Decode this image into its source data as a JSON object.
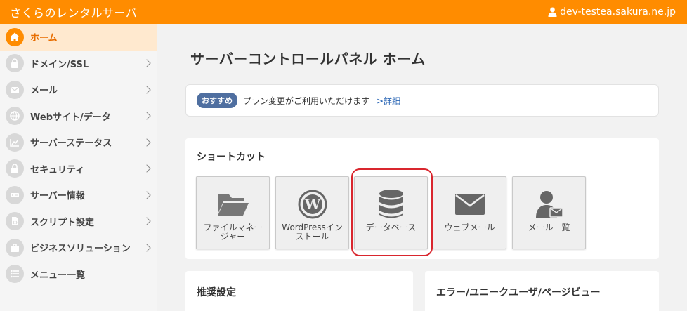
{
  "header": {
    "brand": "さくらのレンタルサーバ",
    "username": "dev-testea.sakura.ne.jp"
  },
  "sidebar": {
    "items": [
      {
        "label": "ホーム",
        "icon": "home-icon",
        "active": true
      },
      {
        "label": "ドメイン/SSL",
        "icon": "lock-icon"
      },
      {
        "label": "メール",
        "icon": "mail-icon"
      },
      {
        "label": "Webサイト/データ",
        "icon": "globe-icon"
      },
      {
        "label": "サーバーステータス",
        "icon": "chart-icon"
      },
      {
        "label": "セキュリティ",
        "icon": "lock-icon"
      },
      {
        "label": "サーバー情報",
        "icon": "server-icon"
      },
      {
        "label": "スクリプト設定",
        "icon": "script-icon"
      },
      {
        "label": "ビジネスソリューション",
        "icon": "briefcase-icon"
      },
      {
        "label": "メニュー一覧",
        "icon": "list-icon"
      }
    ]
  },
  "main": {
    "title": "サーバーコントロールパネル ホーム",
    "notice": {
      "badge": "おすすめ",
      "text": "プラン変更がご利用いただけます",
      "link": ">詳細"
    },
    "shortcuts": {
      "title": "ショートカット",
      "items": [
        {
          "label": "ファイルマネージャー",
          "icon": "folder-icon"
        },
        {
          "label": "WordPressインストール",
          "icon": "wordpress-icon"
        },
        {
          "label": "データベース",
          "icon": "database-icon",
          "highlighted": true
        },
        {
          "label": "ウェブメール",
          "icon": "envelope-icon"
        },
        {
          "label": "メール一覧",
          "icon": "mail-user-icon"
        }
      ]
    },
    "cards": {
      "recommended": "推奨設定",
      "errors": "エラー/ユニークユーザ/ページビュー"
    }
  },
  "colors": {
    "brand": "#ff8c00",
    "active_bg": "#ffe9cf",
    "badge": "#4f6fa0",
    "highlight": "#d9262e",
    "link": "#2a66b5"
  }
}
